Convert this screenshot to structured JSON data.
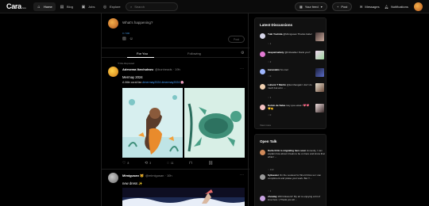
{
  "brand": {
    "name": "Cara",
    "suffix": "beta"
  },
  "nav": [
    {
      "label": "Home",
      "icon": "home-icon",
      "glyph": "⌂"
    },
    {
      "label": "Blog",
      "icon": "blog-icon",
      "glyph": "▤"
    },
    {
      "label": "Jobs",
      "icon": "jobs-icon",
      "glyph": "▣"
    },
    {
      "label": "Explore",
      "icon": "explore-icon",
      "glyph": "◎"
    }
  ],
  "search": {
    "placeholder": "Search"
  },
  "topbar": {
    "feed_label": "Your feed",
    "post_label": "Post",
    "messages_label": "Messages",
    "notifications_label": "Notifications"
  },
  "composer": {
    "placeholder": "What's happening?",
    "char_count": "0 / 600",
    "post_button": "Post"
  },
  "tabs": {
    "for_you": "For You",
    "following": "Following"
  },
  "posts": [
    {
      "repost_note": "Re-Reposted",
      "author": "Adesewa Ikechukwu",
      "handle": "@bunheads · 19h",
      "title": "Mermay 2024",
      "desc_prefix": "A little coral fan ",
      "desc_tags": "#mermay2024 #mermay2024",
      "desc_emoji": "🌸",
      "actions": {
        "likes": "8",
        "reposts": "3",
        "comments": "11"
      }
    },
    {
      "author": "Mimigusan 🐱",
      "handle": "@mimigusan · 10h",
      "title": "new dress ✨"
    }
  ],
  "latest": {
    "title": "Latest Discussions",
    "items": [
      {
        "name": "Yuki Yoshida",
        "handle": "@Mimigusan",
        "text": "Thanks babe!",
        "count": "1"
      },
      {
        "name": "despairnatiety",
        "handle": "",
        "text": "@bnbwalker thank you!!",
        "count": "2"
      },
      {
        "name": "bananakin",
        "handle": "",
        "text": "So cool",
        "count": "0"
      },
      {
        "name": "Lahemi T Martin",
        "handle": "",
        "text": "@kernhangak I don't do much but art n ...",
        "count": "1"
      },
      {
        "name": "Hololo de Salas",
        "handle": "",
        "text": "Hey que estas ! 💖💖💛👏",
        "count": "0"
      }
    ],
    "view_more": "View more"
  },
  "open_talk": {
    "title": "Open Talk",
    "items": [
      {
        "name": "Karla Ortiz is migrating here soon",
        "text": "Honestly, I can explain how about it feels to be on here and know that what I ...",
        "count": "142"
      },
      {
        "name": "Sylwester",
        "text": "On the Lookout for Short Films so I can compliment and praise your work. Bet !! ...",
        "count": "1"
      },
      {
        "name": "chowlay",
        "text": "200 followers!! My art is enjoying a bit of love here :) Thank you all ...",
        "count": "0"
      }
    ]
  },
  "colors": {
    "accent": "#3f8fd8",
    "link": "#4aa3ff",
    "background": "#000000",
    "panel": "#111111"
  }
}
